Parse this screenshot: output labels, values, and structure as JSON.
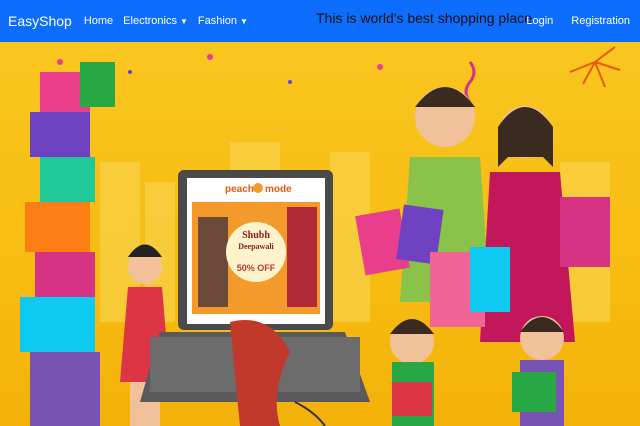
{
  "navbar": {
    "brand": "EasyShop",
    "links": [
      {
        "label": "Home"
      },
      {
        "label": "Electronics",
        "dropdown": true
      },
      {
        "label": "Fashion",
        "dropdown": true
      }
    ],
    "tagline": "This is world's best shopping place",
    "auth": [
      {
        "label": "Login"
      },
      {
        "label": "Registration"
      }
    ],
    "color": "#0d6efd"
  },
  "hero": {
    "screen": {
      "logo_left": "peach",
      "logo_right": "mode",
      "banner_line1": "Shubh",
      "banner_line2": "Deepawali",
      "offer": "50% OFF"
    },
    "accent_colors": {
      "background": "#f7bc11",
      "laptop": "#5a5a5a",
      "banner": "#f39a2b"
    }
  }
}
